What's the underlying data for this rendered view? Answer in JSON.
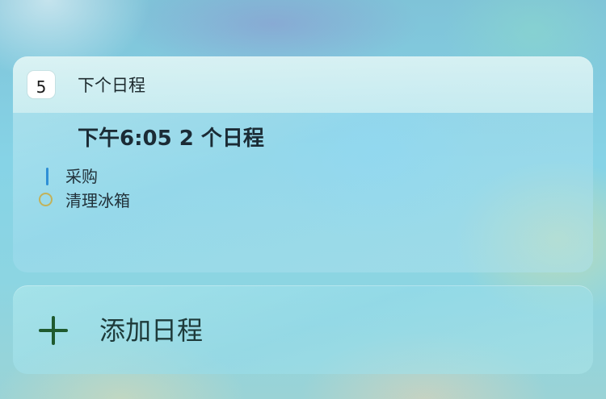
{
  "widget": {
    "title": "下个日程",
    "calendar_icon": {
      "icon": "calendar-app-icon",
      "day": "5"
    },
    "summary": "下午6:05 2 个日程",
    "events": [
      {
        "label": "采购",
        "marker": "bar",
        "color": "#2e8fd6"
      },
      {
        "label": "清理冰箱",
        "marker": "ring",
        "color": "#c2b25a"
      }
    ]
  },
  "add_event": {
    "icon": "plus-icon",
    "label": "添加日程"
  }
}
